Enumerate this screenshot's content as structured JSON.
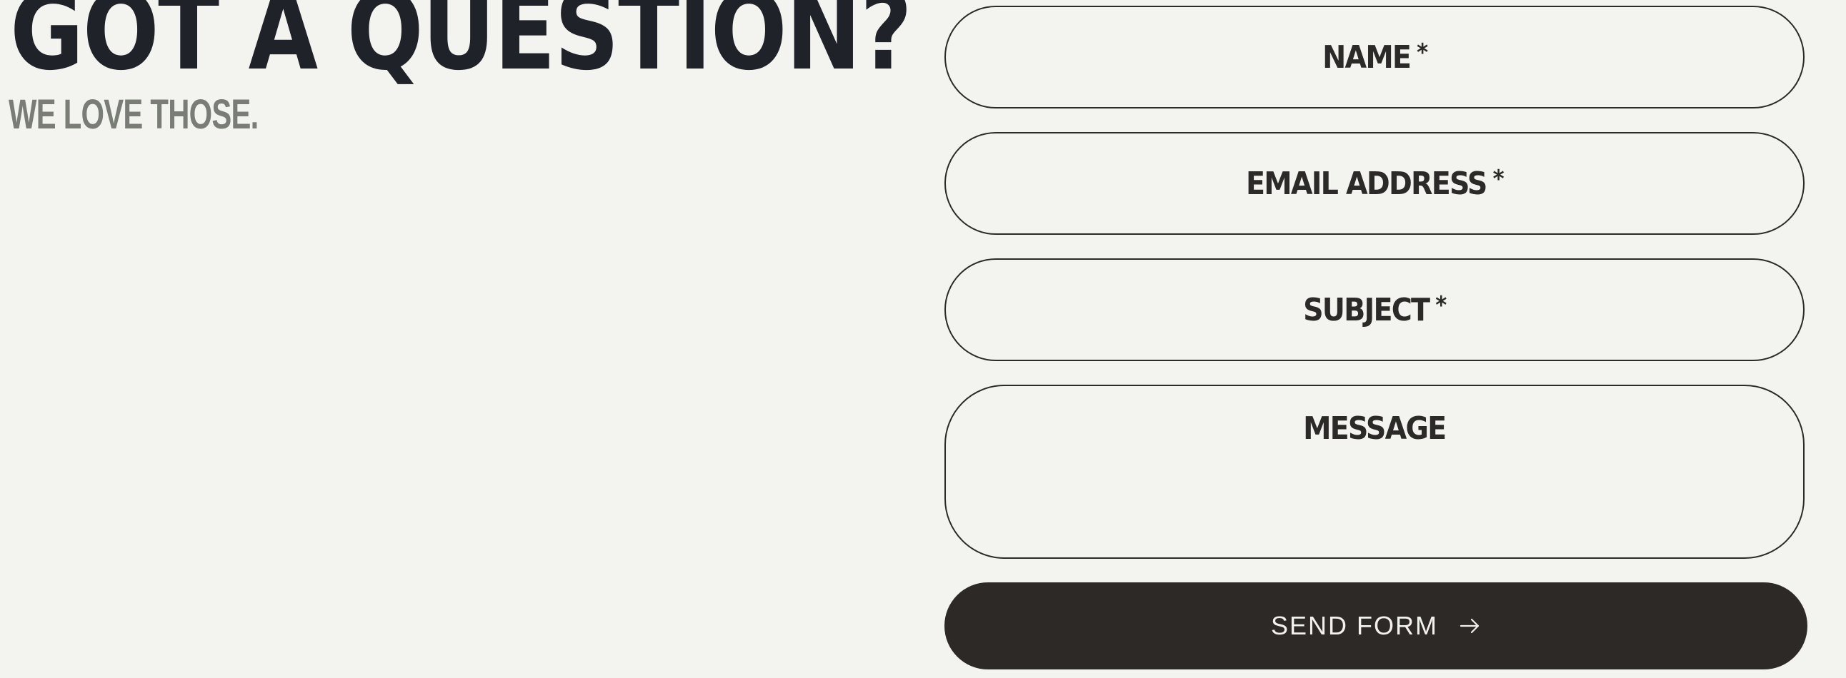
{
  "header": {
    "title": "GOT A QUESTION?",
    "subtitle": "WE LOVE THOSE."
  },
  "form": {
    "fields": [
      {
        "label": "NAME",
        "required": "*"
      },
      {
        "label": "EMAIL ADDRESS",
        "required": "*"
      },
      {
        "label": "SUBJECT",
        "required": "*"
      },
      {
        "label": "MESSAGE"
      }
    ],
    "submit_label": "SEND FORM",
    "submit_icon": "arrow-right-icon"
  },
  "colors": {
    "background": "#f3f3ef",
    "text": "#1f2228",
    "muted_text": "#7a7d76",
    "button_bg": "#2c2926",
    "button_text": "#f2f1ec"
  }
}
